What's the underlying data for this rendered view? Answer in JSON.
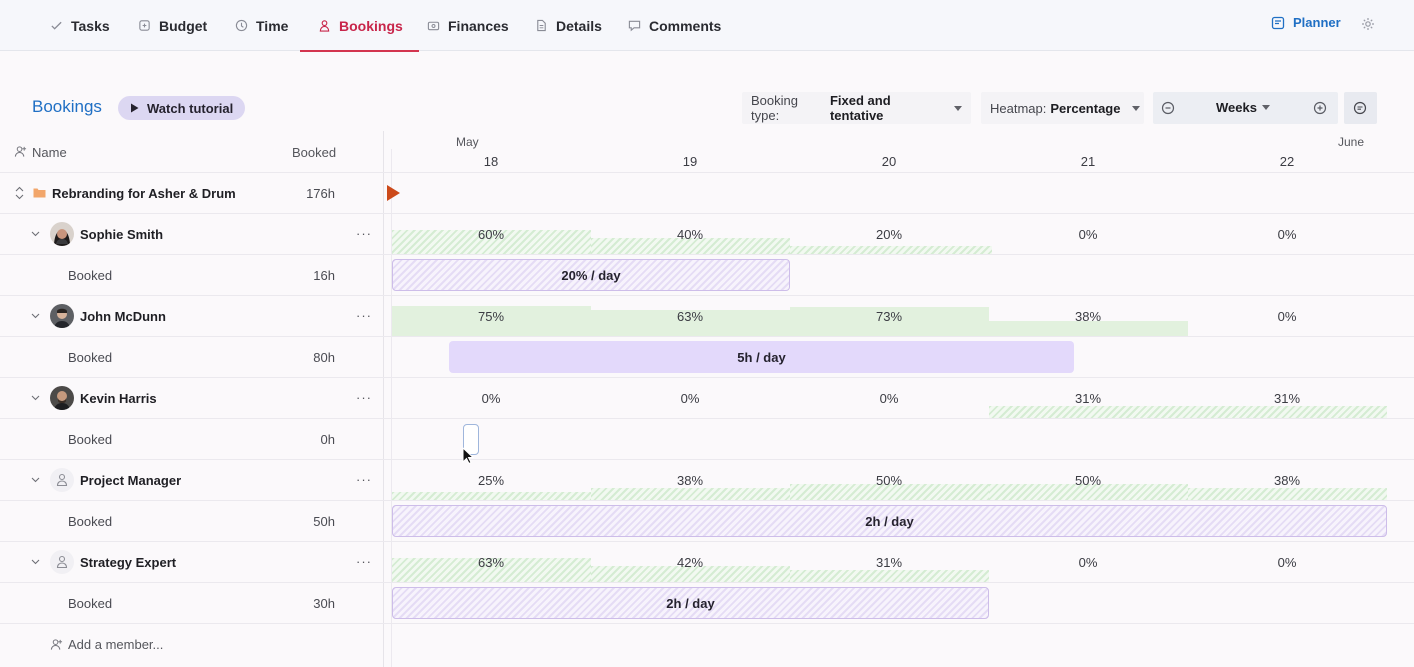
{
  "nav": {
    "tabs": [
      {
        "label": "Tasks",
        "icon": "check-icon"
      },
      {
        "label": "Budget",
        "icon": "budget-icon"
      },
      {
        "label": "Time",
        "icon": "clock-icon"
      },
      {
        "label": "Bookings",
        "icon": "person-icon",
        "active": true
      },
      {
        "label": "Finances",
        "icon": "finances-icon"
      },
      {
        "label": "Details",
        "icon": "document-icon"
      },
      {
        "label": "Comments",
        "icon": "comment-icon"
      }
    ],
    "planner_label": "Planner",
    "accent": "#c8254a",
    "link_color": "#1f6fc4"
  },
  "toolbar": {
    "title": "Bookings",
    "tutorial_label": "Watch tutorial",
    "booking_type_label": "Booking type:",
    "booking_type_value": "Fixed and tentative",
    "heatmap_label": "Heatmap:",
    "heatmap_value": "Percentage",
    "zoom_value": "Weeks"
  },
  "left": {
    "name_header": "Name",
    "booked_header": "Booked",
    "project": {
      "name": "Rebranding for Asher & Drum",
      "hours": "176h"
    },
    "members": [
      {
        "name": "Sophie Smith",
        "type": "person",
        "booked_label": "Booked",
        "booked_hours": "16h"
      },
      {
        "name": "John McDunn",
        "type": "person",
        "booked_label": "Booked",
        "booked_hours": "80h"
      },
      {
        "name": "Kevin Harris",
        "type": "person",
        "booked_label": "Booked",
        "booked_hours": "0h"
      },
      {
        "name": "Project Manager",
        "type": "role",
        "booked_label": "Booked",
        "booked_hours": "50h"
      },
      {
        "name": "Strategy Expert",
        "type": "role",
        "booked_label": "Booked",
        "booked_hours": "30h"
      }
    ],
    "add_member_label": "Add a member..."
  },
  "timeline": {
    "months": [
      "May",
      "June"
    ],
    "days": [
      "18",
      "19",
      "20",
      "21",
      "22"
    ],
    "heatmap": [
      [
        "60%",
        "40%",
        "20%",
        "0%",
        "0%"
      ],
      [
        "75%",
        "63%",
        "73%",
        "38%",
        "0%"
      ],
      [
        "0%",
        "0%",
        "0%",
        "31%",
        "31%"
      ],
      [
        "25%",
        "38%",
        "50%",
        "50%",
        "38%"
      ],
      [
        "63%",
        "42%",
        "31%",
        "0%",
        "0%"
      ]
    ],
    "bookings": [
      {
        "label": "20% / day",
        "kind": "tentative"
      },
      {
        "label": "5h / day",
        "kind": "fixed"
      },
      {
        "label": "",
        "kind": "empty"
      },
      {
        "label": "2h / day",
        "kind": "tentative"
      },
      {
        "label": "2h / day",
        "kind": "tentative"
      }
    ]
  }
}
